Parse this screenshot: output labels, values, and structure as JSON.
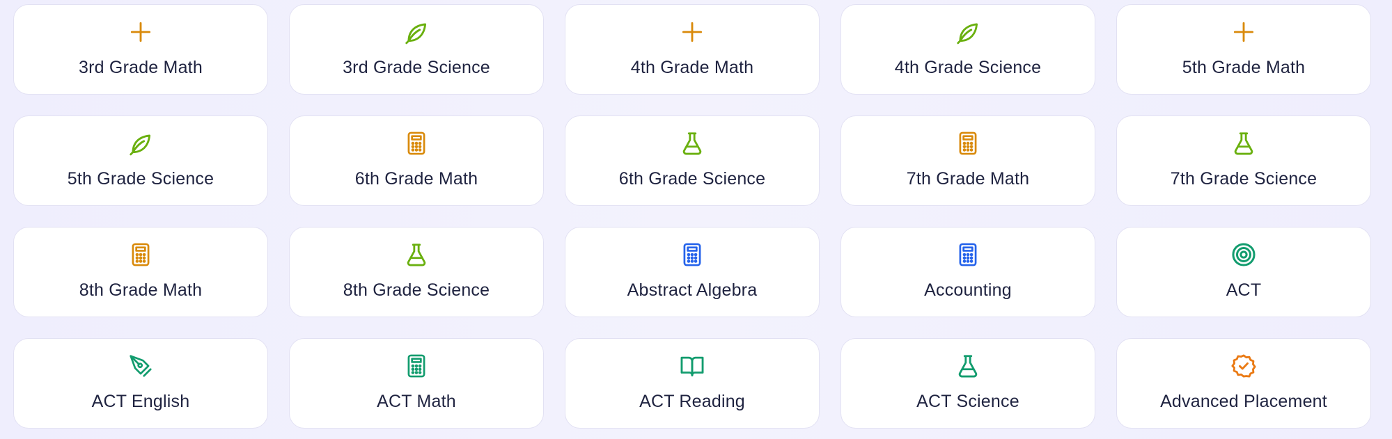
{
  "colors": {
    "math": "#d98a0b",
    "science": "#6ab00f",
    "blue": "#2563eb",
    "green": "#129c6e",
    "orange": "#ea7a14",
    "text": "#1f2340"
  },
  "cards": [
    {
      "label": "3rd Grade Math",
      "icon": "plus-icon",
      "color": "#d98a0b"
    },
    {
      "label": "3rd Grade Science",
      "icon": "leaf-icon",
      "color": "#6ab00f"
    },
    {
      "label": "4th Grade Math",
      "icon": "plus-icon",
      "color": "#d98a0b"
    },
    {
      "label": "4th Grade Science",
      "icon": "leaf-icon",
      "color": "#6ab00f"
    },
    {
      "label": "5th Grade Math",
      "icon": "plus-icon",
      "color": "#d98a0b"
    },
    {
      "label": "5th Grade Science",
      "icon": "leaf-icon",
      "color": "#6ab00f"
    },
    {
      "label": "6th Grade Math",
      "icon": "calculator-icon",
      "color": "#d98a0b"
    },
    {
      "label": "6th Grade Science",
      "icon": "flask-icon",
      "color": "#6ab00f"
    },
    {
      "label": "7th Grade Math",
      "icon": "calculator-icon",
      "color": "#d98a0b"
    },
    {
      "label": "7th Grade Science",
      "icon": "flask-icon",
      "color": "#6ab00f"
    },
    {
      "label": "8th Grade Math",
      "icon": "calculator-icon",
      "color": "#d98a0b"
    },
    {
      "label": "8th Grade Science",
      "icon": "flask-icon",
      "color": "#6ab00f"
    },
    {
      "label": "Abstract Algebra",
      "icon": "calculator-icon",
      "color": "#2563eb"
    },
    {
      "label": "Accounting",
      "icon": "calculator-icon",
      "color": "#2563eb"
    },
    {
      "label": "ACT",
      "icon": "target-icon",
      "color": "#129c6e"
    },
    {
      "label": "ACT English",
      "icon": "pen-nib-icon",
      "color": "#129c6e"
    },
    {
      "label": "ACT Math",
      "icon": "calculator-icon",
      "color": "#129c6e"
    },
    {
      "label": "ACT Reading",
      "icon": "book-open-icon",
      "color": "#129c6e"
    },
    {
      "label": "ACT Science",
      "icon": "flask-icon",
      "color": "#129c6e"
    },
    {
      "label": "Advanced Placement",
      "icon": "badge-check-icon",
      "color": "#ea7a14"
    }
  ]
}
